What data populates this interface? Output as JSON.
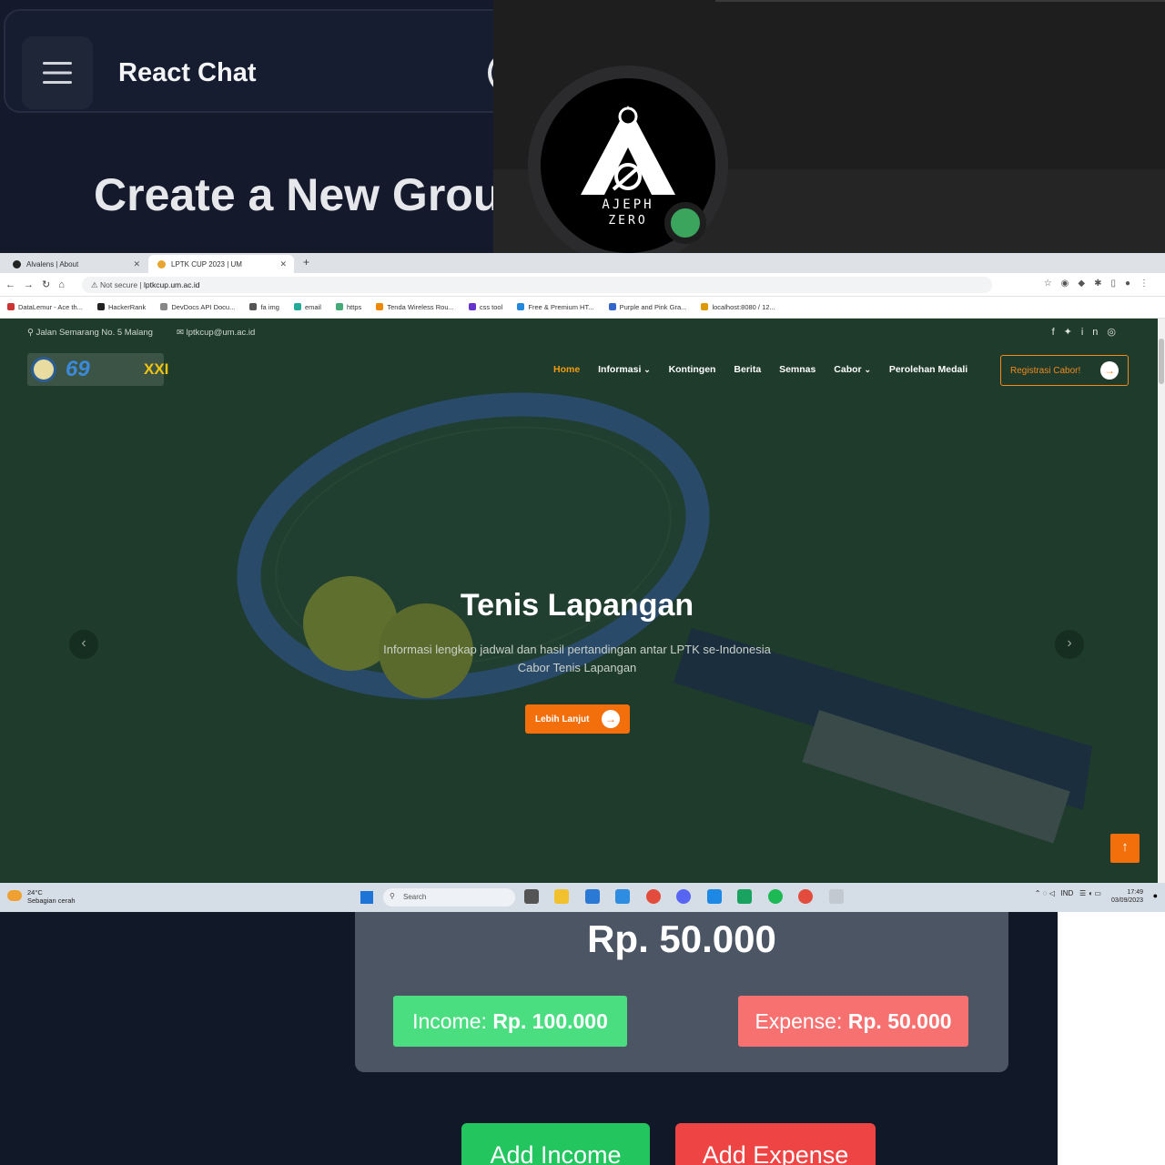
{
  "react_chat": {
    "app_title": "React Chat",
    "page_heading": "Create a New Grou"
  },
  "profile": {
    "logo_text_line1": "AJEPH",
    "logo_text_line2": "ZERO",
    "status_color": "#3ba55d"
  },
  "browser": {
    "tabs": [
      {
        "label": "Alvalens | About"
      },
      {
        "label": "LPTK CUP 2023 | UM"
      }
    ],
    "security_label": "Not secure",
    "url": "lptkcup.um.ac.id",
    "bookmarks": [
      "DataLemur - Ace th...",
      "HackerRank",
      "DevDocs API Docu...",
      "fa img",
      "email",
      "https",
      "Tenda Wireless Rou...",
      "css tool",
      "Free & Premium HT...",
      "Purple and Pink Gra...",
      "localhost:8080 / 12..."
    ],
    "site": {
      "address": "Jalan Semarang No. 5 Malang",
      "email": "lptkcup@um.ac.id",
      "nav": {
        "home": "Home",
        "informasi": "Informasi",
        "kontingen": "Kontingen",
        "berita": "Berita",
        "semnas": "Semnas",
        "cabor": "Cabor",
        "perolehan": "Perolehan Medali"
      },
      "register_button": "Registrasi Cabor!",
      "logo_number": "69",
      "logo_roman": "XXI",
      "hero_title": "Tenis Lapangan",
      "hero_subtitle_line1": "Informasi lengkap jadwal dan hasil pertandingan antar LPTK se-Indonesia",
      "hero_subtitle_line2": "Cabor Tenis Lapangan",
      "cta_button": "Lebih Lanjut",
      "accent_color": "#f26f0c"
    },
    "taskbar": {
      "temperature": "24°C",
      "weather": "Sebagian cerah",
      "search_placeholder": "Search",
      "language": "IND",
      "time": "17:49",
      "date": "03/09/2023"
    }
  },
  "tracker": {
    "balance": "Rp. 50.000",
    "income_label": "Income:",
    "income_value": "Rp. 100.000",
    "expense_label": "Expense:",
    "expense_value": "Rp. 50.000",
    "add_income_button": "Add Income",
    "add_expense_button": "Add Expense"
  }
}
